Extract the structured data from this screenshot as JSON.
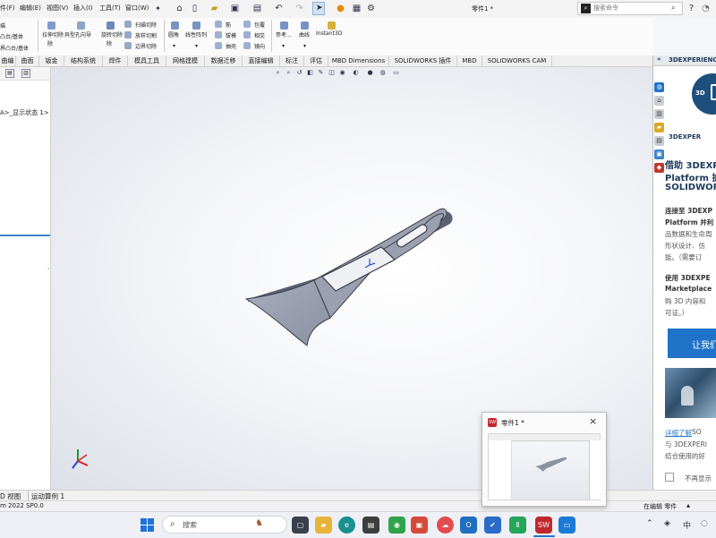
{
  "menubar": {
    "items": [
      "件(F)",
      "编辑(E)",
      "视图(V)",
      "插入(I)",
      "工具(T)",
      "窗口(W)"
    ],
    "doc_title": "零件1 *",
    "search_placeholder": "搜索命令"
  },
  "ribbon": {
    "left_labels": [
      "凸台/基体",
      "描",
      "界凸台/基体"
    ],
    "group2": [
      "拉伸切除",
      "异型孔向导",
      "旋转切除"
    ],
    "cuts": [
      "扫描切除",
      "放样切割",
      "边界切除"
    ],
    "features": [
      "圆角",
      "线性阵列",
      "筋",
      "包覆",
      "拔模",
      "相交",
      "抽壳",
      "镜向"
    ],
    "tail": [
      "参考...",
      "曲线",
      "Instant3D"
    ]
  },
  "tabs": [
    "曲编",
    "曲面",
    "钣金",
    "结构系统",
    "焊件",
    "模具工具",
    "网格建模",
    "数据迁移",
    "直接编辑",
    "标注",
    "评估",
    "MBD Dimensions",
    "SOLIDWORKS 插件",
    "MBD",
    "SOLIDWORKS CAM"
  ],
  "leftpanel": {
    "tree_item": "A>_显示状态 1>"
  },
  "bottom_tabs": [
    "D 视图",
    "运动算例 1"
  ],
  "status": {
    "left": "m 2022 SP0.0",
    "right": "在编辑 零件"
  },
  "rightpanel": {
    "header": "3DEXPERIENCE",
    "logo_text": "3DEXPER",
    "headline_lines": [
      "借助 3DEXP",
      "Platform 扩",
      "SOLIDWORK"
    ],
    "para1_lines": [
      "连接至 3DEXP",
      "Platform 并利",
      "品数据和生命周",
      "形状设计、仿",
      "能。（需要订"
    ],
    "para2_lines": [
      "使用 3DEXPE",
      "Marketplace",
      "购 3D 内容和",
      "可证。）"
    ],
    "cta_button": "让我们",
    "link_text": "详细了解",
    "link_tail": " SO",
    "footer_lines": [
      "与 3DEXPERI",
      "结合使用的好"
    ],
    "checkbox_label": "不再显示"
  },
  "thumbnail": {
    "title": "零件1 *",
    "close": "×"
  },
  "taskbar": {
    "search_placeholder": "搜索",
    "ime": "中"
  },
  "colors": {
    "accent_blue": "#1f73c8",
    "link_blue": "#2a7ac6",
    "header_dark": "#1a3a5a",
    "part_face": "#9ea4b3",
    "part_edge": "#3b3f4a"
  }
}
